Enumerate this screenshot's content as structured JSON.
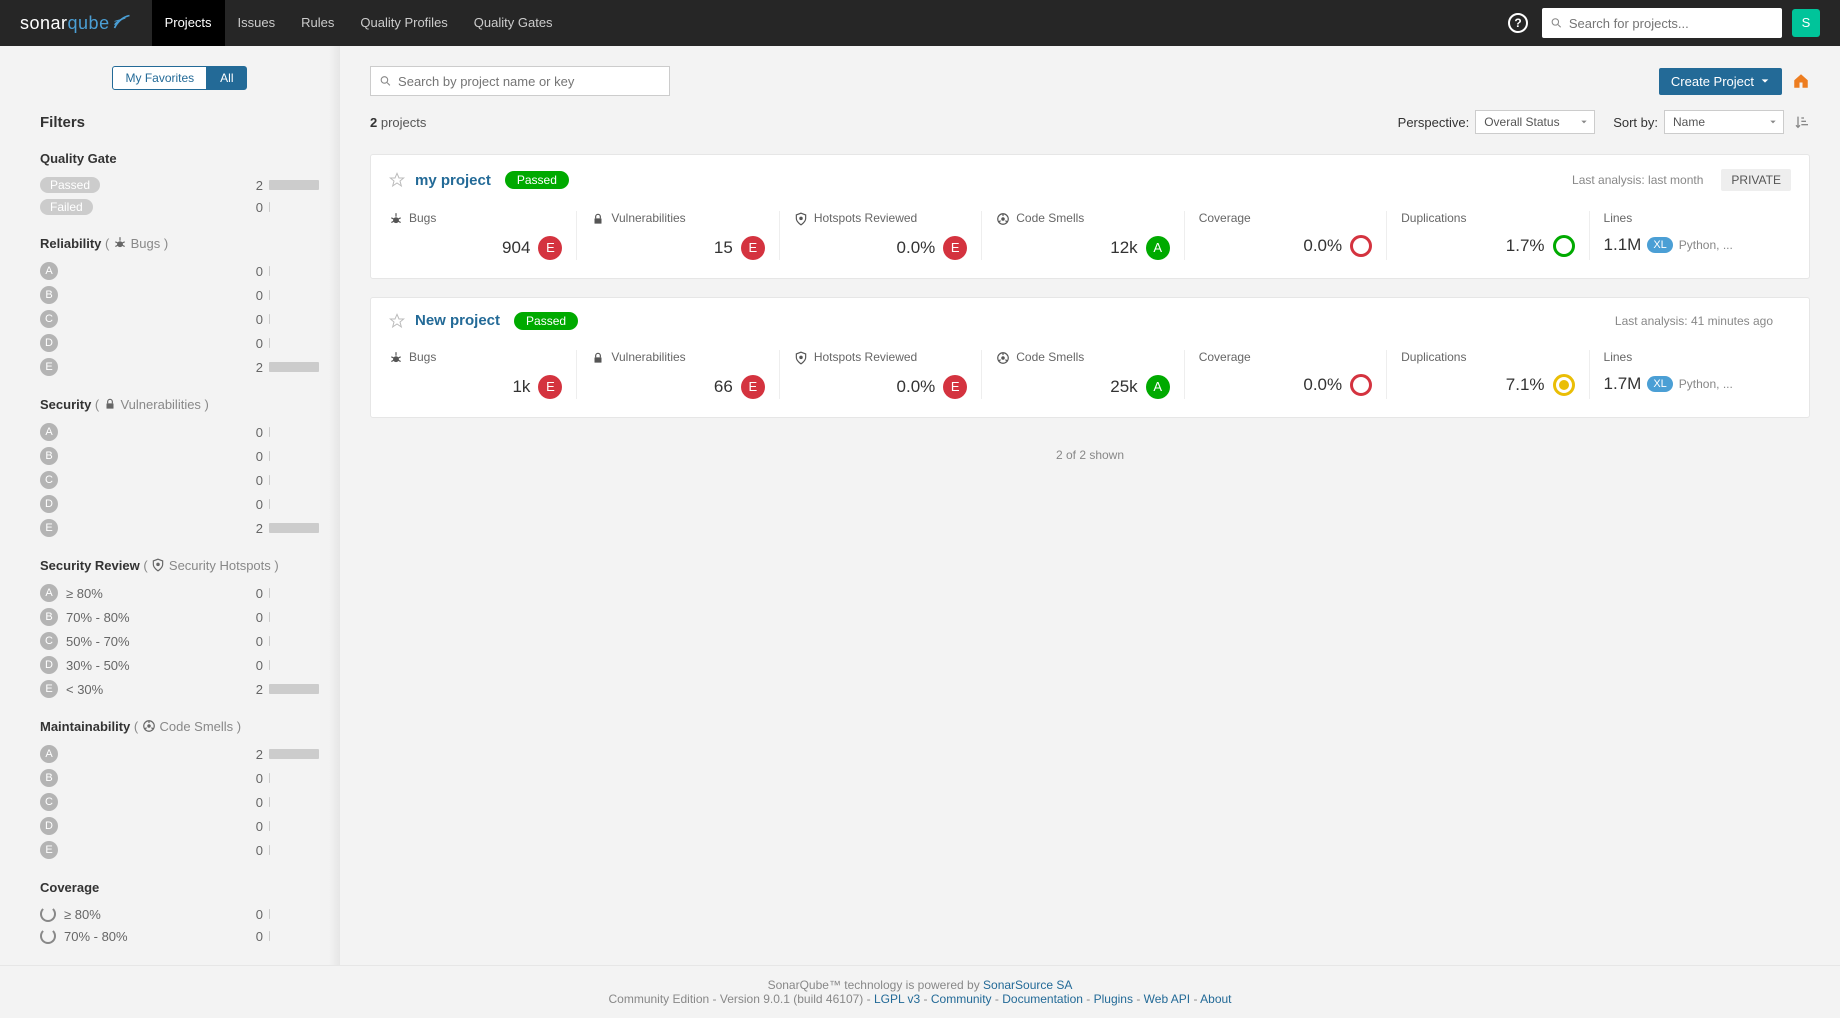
{
  "brand": {
    "text1": "sonar",
    "text2": "qube"
  },
  "nav": {
    "projects": "Projects",
    "issues": "Issues",
    "rules": "Rules",
    "profiles": "Quality Profiles",
    "gates": "Quality Gates"
  },
  "search_placeholder": "Search for projects...",
  "avatar": "S",
  "sidebar": {
    "fav": "My Favorites",
    "all": "All",
    "filters_heading": "Filters",
    "qg": {
      "title": "Quality Gate",
      "passed": {
        "label": "Passed",
        "count": "2"
      },
      "failed": {
        "label": "Failed",
        "count": "0"
      }
    },
    "reliability": {
      "title": "Reliability",
      "sub": "Bugs",
      "rows": [
        {
          "g": "A",
          "c": "0"
        },
        {
          "g": "B",
          "c": "0"
        },
        {
          "g": "C",
          "c": "0"
        },
        {
          "g": "D",
          "c": "0"
        },
        {
          "g": "E",
          "c": "2",
          "hasBar": true
        }
      ]
    },
    "security": {
      "title": "Security",
      "sub": "Vulnerabilities",
      "rows": [
        {
          "g": "A",
          "c": "0"
        },
        {
          "g": "B",
          "c": "0"
        },
        {
          "g": "C",
          "c": "0"
        },
        {
          "g": "D",
          "c": "0"
        },
        {
          "g": "E",
          "c": "2",
          "hasBar": true
        }
      ]
    },
    "secreview": {
      "title": "Security Review",
      "sub": "Security Hotspots",
      "rows": [
        {
          "g": "A",
          "l": "≥ 80%",
          "c": "0"
        },
        {
          "g": "B",
          "l": "70% - 80%",
          "c": "0"
        },
        {
          "g": "C",
          "l": "50% - 70%",
          "c": "0"
        },
        {
          "g": "D",
          "l": "30% - 50%",
          "c": "0"
        },
        {
          "g": "E",
          "l": "< 30%",
          "c": "2",
          "hasBar": true
        }
      ]
    },
    "maint": {
      "title": "Maintainability",
      "sub": "Code Smells",
      "rows": [
        {
          "g": "A",
          "c": "2",
          "hasBar": true
        },
        {
          "g": "B",
          "c": "0"
        },
        {
          "g": "C",
          "c": "0"
        },
        {
          "g": "D",
          "c": "0"
        },
        {
          "g": "E",
          "c": "0"
        }
      ]
    },
    "coverage": {
      "title": "Coverage",
      "rows": [
        {
          "l": "≥ 80%",
          "c": "0"
        },
        {
          "l": "70% - 80%",
          "c": "0"
        }
      ]
    }
  },
  "main": {
    "proj_search_placeholder": "Search by project name or key",
    "create_btn": "Create Project",
    "count": "2",
    "count_suffix": "projects",
    "perspective_label": "Perspective:",
    "perspective_value": "Overall Status",
    "sort_label": "Sort by:",
    "sort_value": "Name",
    "projects": [
      {
        "name": "my project",
        "status": "Passed",
        "analysis": "Last analysis: last month",
        "private": "PRIVATE",
        "bugs": {
          "label": "Bugs",
          "value": "904",
          "rating": "E"
        },
        "vuln": {
          "label": "Vulnerabilities",
          "value": "15",
          "rating": "E"
        },
        "hot": {
          "label": "Hotspots Reviewed",
          "value": "0.0%",
          "rating": "E"
        },
        "smells": {
          "label": "Code Smells",
          "value": "12k",
          "rating": "A"
        },
        "cov": {
          "label": "Coverage",
          "value": "0.0%",
          "ring": "red"
        },
        "dup": {
          "label": "Duplications",
          "value": "1.7%",
          "ring": "green"
        },
        "lines": {
          "label": "Lines",
          "value": "1.1M",
          "size": "XL",
          "langs": "Python, ..."
        }
      },
      {
        "name": "New project",
        "status": "Passed",
        "analysis": "Last analysis: 41 minutes ago",
        "private": "",
        "bugs": {
          "label": "Bugs",
          "value": "1k",
          "rating": "E"
        },
        "vuln": {
          "label": "Vulnerabilities",
          "value": "66",
          "rating": "E"
        },
        "hot": {
          "label": "Hotspots Reviewed",
          "value": "0.0%",
          "rating": "E"
        },
        "smells": {
          "label": "Code Smells",
          "value": "25k",
          "rating": "A"
        },
        "cov": {
          "label": "Coverage",
          "value": "0.0%",
          "ring": "red"
        },
        "dup": {
          "label": "Duplications",
          "value": "7.1%",
          "ring": "yellow"
        },
        "lines": {
          "label": "Lines",
          "value": "1.7M",
          "size": "XL",
          "langs": "Python, ..."
        }
      }
    ],
    "shown": "2 of 2 shown"
  },
  "footer": {
    "line1_a": "SonarQube™ technology is powered by ",
    "line1_b": "SonarSource SA",
    "line2_a": "Community Edition - Version 9.0.1 (build 46107) - ",
    "links": [
      "LGPL v3",
      "Community",
      "Documentation",
      "Plugins",
      "Web API",
      "About"
    ]
  }
}
